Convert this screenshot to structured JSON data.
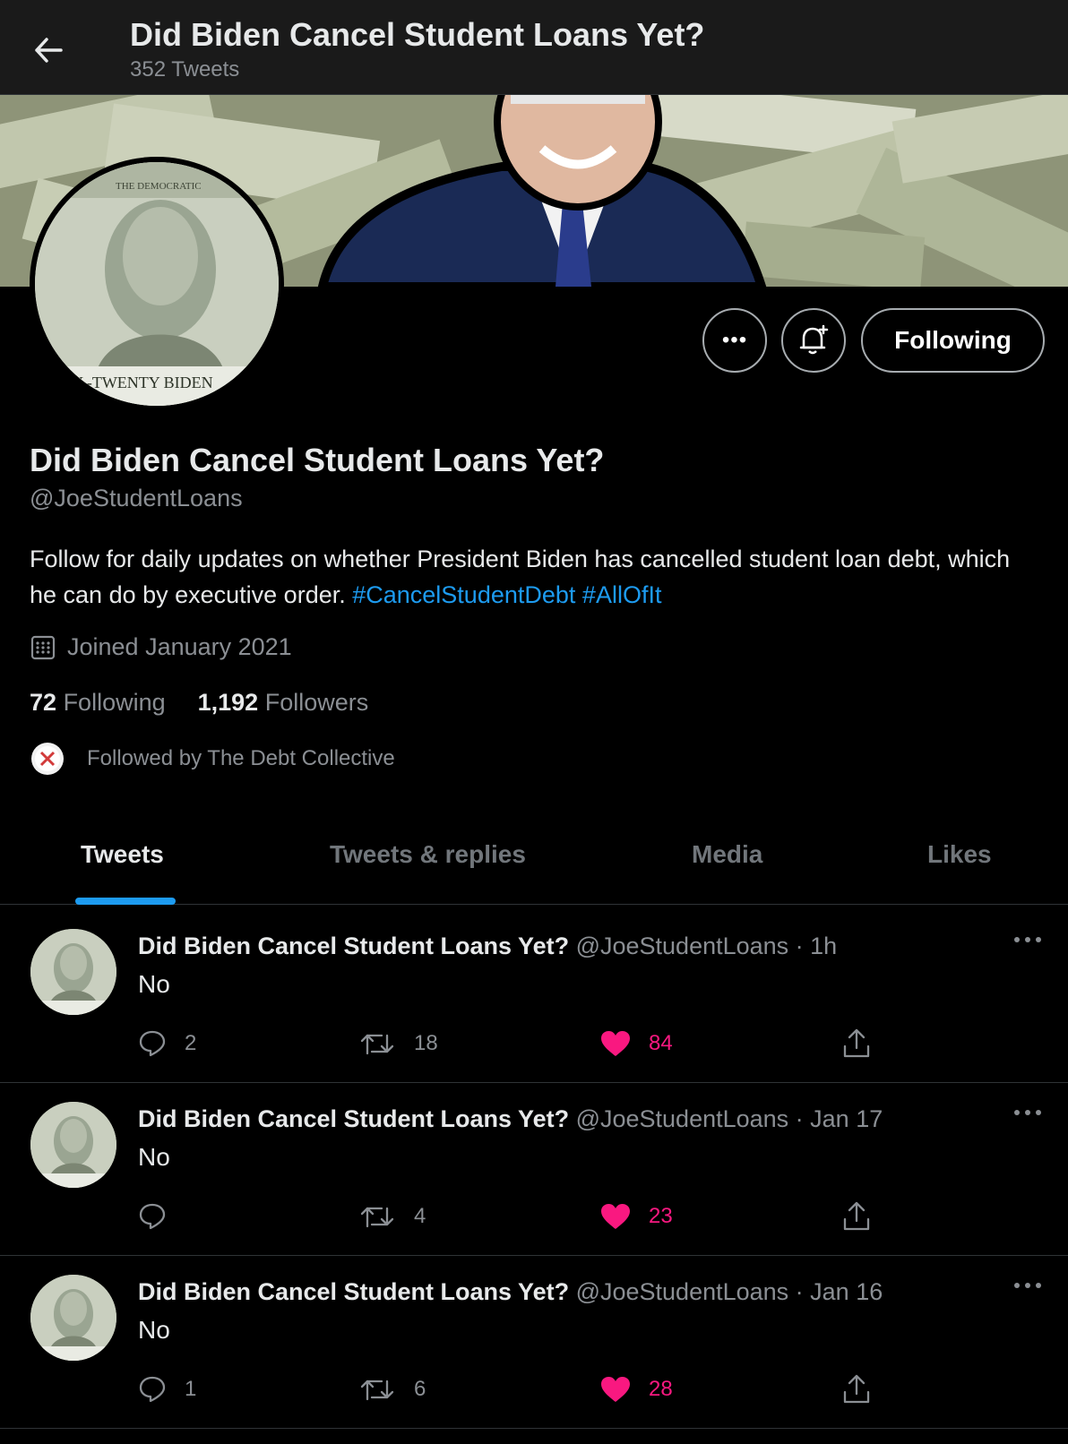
{
  "header": {
    "title": "Did Biden Cancel Student Loans Yet?",
    "tweet_count": "352 Tweets"
  },
  "banner": {
    "avatar_text_top": "THE DEMOCRATIC",
    "avatar_text_bottom": "TY -TWENTY BIDEN"
  },
  "actions": {
    "more_label": "•••",
    "following_label": "Following"
  },
  "profile": {
    "name": "Did Biden Cancel Student Loans Yet?",
    "handle": "@JoeStudentLoans",
    "bio_text": "Follow for daily updates on whether President Biden has cancelled student loan debt, which he can do by executive order. ",
    "hashtag_1": "#CancelStudentDebt",
    "hashtag_2": "#AllOfIt",
    "joined": "Joined January 2021",
    "following_count": "72",
    "following_label": "Following",
    "followers_count": "1,192",
    "followers_label": "Followers",
    "followed_by": "Followed by The Debt Collective"
  },
  "tabs": [
    {
      "label": "Tweets"
    },
    {
      "label": "Tweets & replies"
    },
    {
      "label": "Media"
    },
    {
      "label": "Likes"
    }
  ],
  "tweets": [
    {
      "name": "Did Biden Cancel Student Loans Yet?",
      "meta": " @JoeStudentLoans · 1h",
      "text": "No",
      "replies": "2",
      "retweets": "18",
      "likes": "84"
    },
    {
      "name": "Did Biden Cancel Student Loans Yet?",
      "meta": " @JoeStudentLoans · Jan 17",
      "text": "No",
      "replies": "",
      "retweets": "4",
      "likes": "23"
    },
    {
      "name": "Did Biden Cancel Student Loans Yet?",
      "meta": " @JoeStudentLoans · Jan 16",
      "text": "No",
      "replies": "1",
      "retweets": "6",
      "likes": "28"
    }
  ],
  "colors": {
    "accent": "#1d9bf0",
    "like": "#f91880",
    "muted": "#8b8f94"
  }
}
